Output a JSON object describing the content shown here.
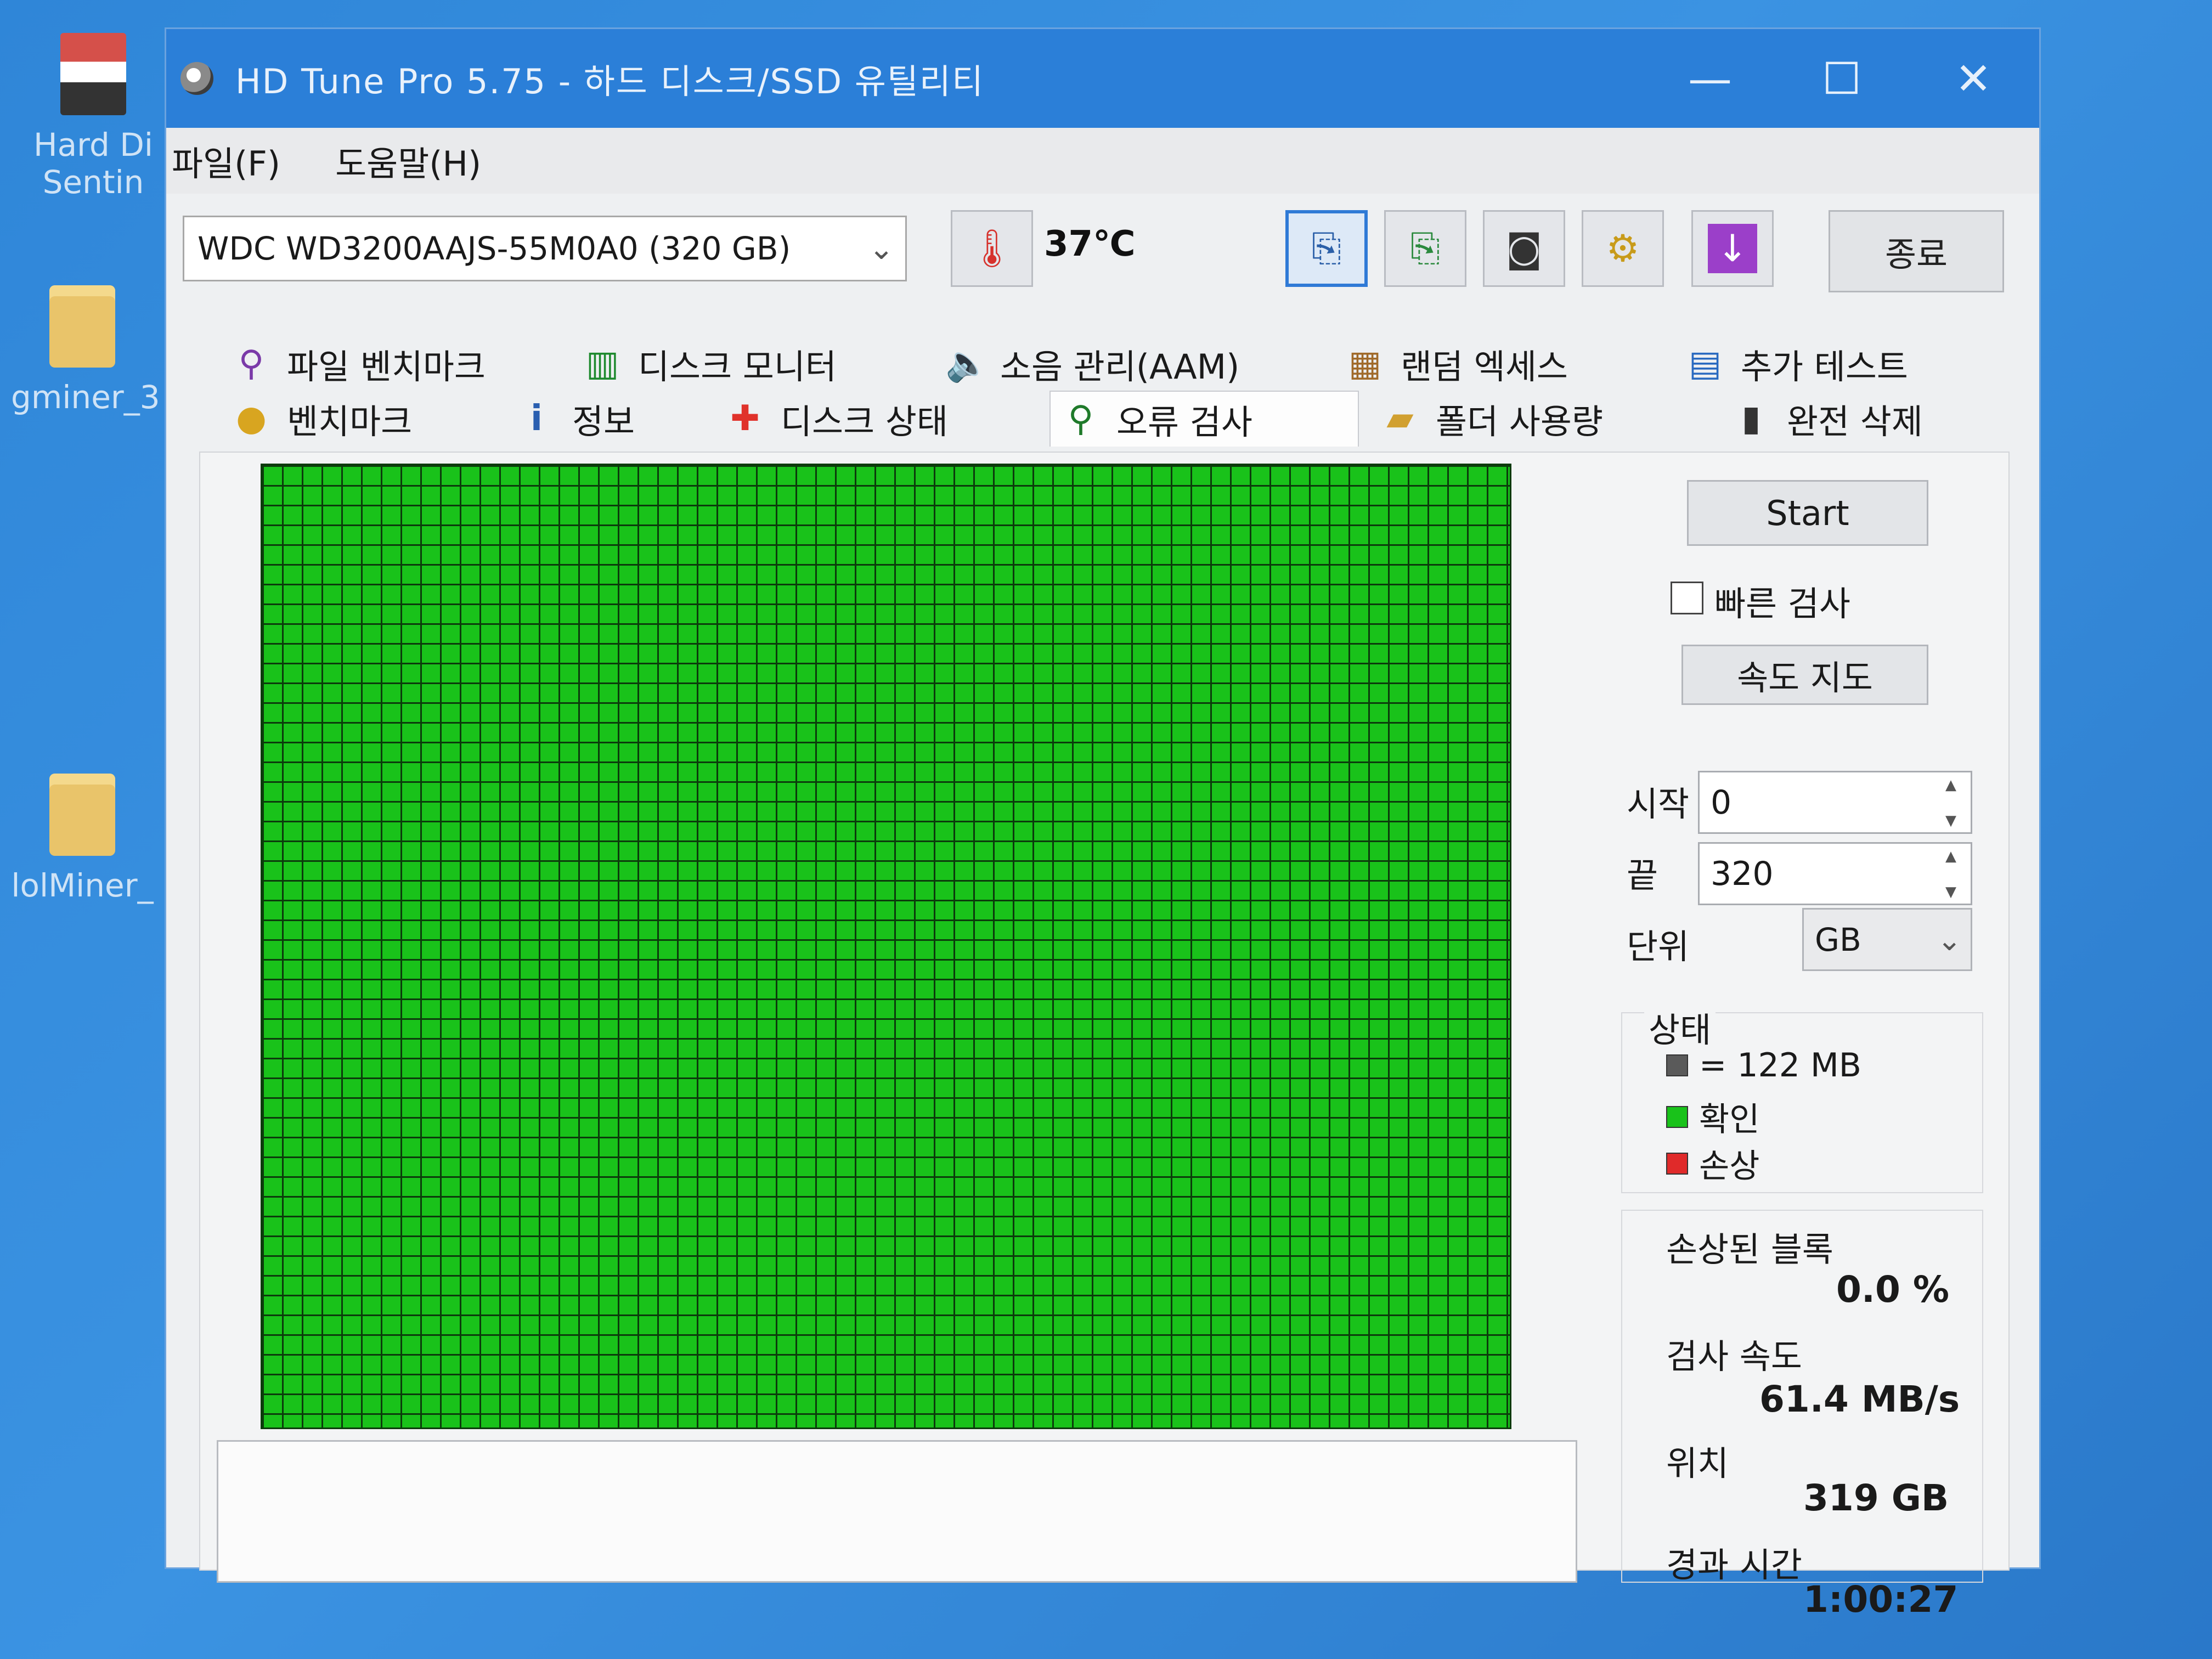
{
  "desktop": {
    "icons": [
      {
        "label": "Hard Di\nSentin"
      },
      {
        "label": "gminer_3"
      },
      {
        "label": "lolMiner_"
      }
    ]
  },
  "window": {
    "title": "HD Tune Pro 5.75 - 하드 디스크/SSD 유틸리티",
    "controls": {
      "minimize": "—",
      "maximize": "☐",
      "close": "✕"
    }
  },
  "menu": {
    "file": "파일(F)",
    "help": "도움말(H)"
  },
  "toolbar": {
    "drive": "WDC WD3200AAJS-55M0A0 (320 GB)",
    "temperature": "37℃",
    "exit_label": "종료"
  },
  "tabs": {
    "row1": [
      "파일 벤치마크",
      "디스크 모니터",
      "소음 관리(AAM)",
      "랜덤 엑세스",
      "추가 테스트"
    ],
    "row2": [
      "벤치마크",
      "정보",
      "디스크 상태",
      "오류 검사",
      "폴더 사용량",
      "완전 삭제"
    ],
    "selected": "오류 검사"
  },
  "error_scan": {
    "start_label": "Start",
    "quick_scan_label": "빠른 검사",
    "quick_scan_checked": false,
    "speed_map_label": "속도 지도",
    "start_field_label": "시작",
    "start_value": "0",
    "end_field_label": "끝",
    "end_value": "320",
    "unit_label": "단위",
    "unit_value": "GB",
    "status_title": "상태",
    "legend": [
      {
        "label": "= 122 MB",
        "color": "#5a5a5a"
      },
      {
        "label": "확인",
        "color": "#19c21a"
      },
      {
        "label": "손상",
        "color": "#e02a2a"
      }
    ],
    "damaged_blocks_label": "손상된 블록",
    "damaged_blocks_value": "0.0 %",
    "scan_speed_label": "검사 속도",
    "scan_speed_value": "61.4 MB/s",
    "position_label": "위치",
    "position_value": "319 GB",
    "elapsed_label": "경과 시간",
    "elapsed_value": "1:00:27"
  }
}
